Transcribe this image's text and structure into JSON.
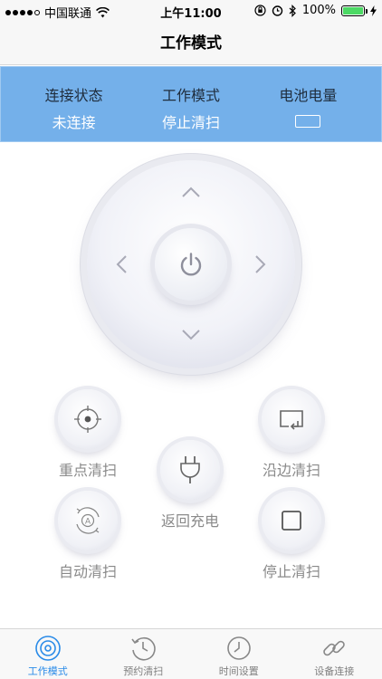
{
  "status_bar": {
    "carrier": "中国联通",
    "time": "上午11:00",
    "battery_percent": "100%",
    "signal_bars": 4
  },
  "nav": {
    "title": "工作模式"
  },
  "info": {
    "connection": {
      "label": "连接状态",
      "value": "未连接"
    },
    "mode": {
      "label": "工作模式",
      "value": "停止清扫"
    },
    "battery": {
      "label": "电池电量",
      "icon": "battery-outline-icon"
    }
  },
  "dpad": {
    "up_icon": "chevron-up-icon",
    "down_icon": "chevron-down-icon",
    "left_icon": "chevron-left-icon",
    "right_icon": "chevron-right-icon",
    "center_icon": "power-icon"
  },
  "actions": {
    "spot": {
      "label": "重点清扫",
      "icon": "crosshair-icon"
    },
    "edge": {
      "label": "沿边清扫",
      "icon": "return-arrow-icon"
    },
    "charge": {
      "label": "返回充电",
      "icon": "plug-icon"
    },
    "auto": {
      "label": "自动清扫",
      "icon": "auto-cycle-icon"
    },
    "stop": {
      "label": "停止清扫",
      "icon": "stop-square-icon"
    }
  },
  "tabs": [
    {
      "label": "工作模式",
      "icon": "target-icon",
      "active": true
    },
    {
      "label": "预约清扫",
      "icon": "history-clock-icon",
      "active": false
    },
    {
      "label": "时间设置",
      "icon": "clock-icon",
      "active": false
    },
    {
      "label": "设备连接",
      "icon": "link-icon",
      "active": false
    }
  ],
  "colors": {
    "panel_blue": "#74b0ea",
    "tab_active": "#2a8be8",
    "battery_green": "#4cd964"
  }
}
